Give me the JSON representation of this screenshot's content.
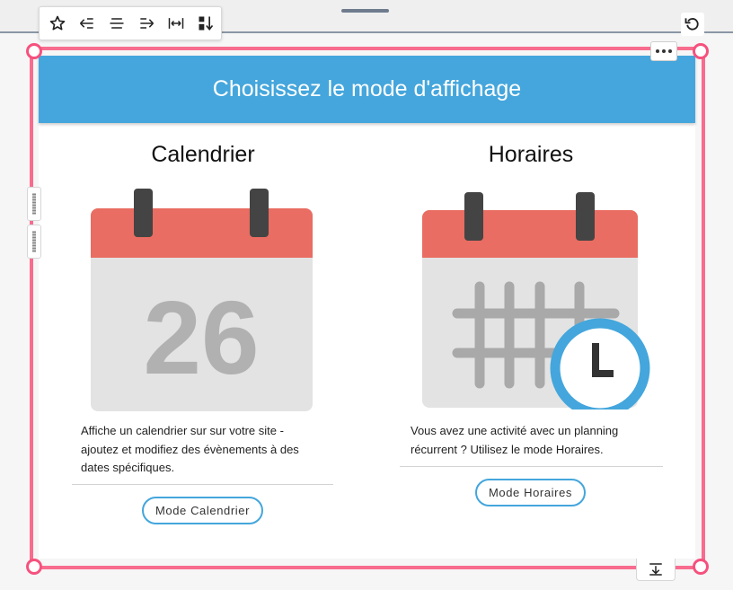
{
  "toolbar": {
    "icons": [
      "star-icon",
      "align-left-icon",
      "align-center-icon",
      "align-right-icon",
      "stretch-icon",
      "sort-icon"
    ]
  },
  "header": {
    "title": "Choisissez le mode d'affichage"
  },
  "calendar": {
    "title": "Calendrier",
    "day_number": "26",
    "description_lines": [
      "Affiche un calendrier sur sur votre site -",
      "ajoutez et modifiez des évènements à des",
      "dates spécifiques."
    ],
    "button_label": "Mode Calendrier"
  },
  "schedule": {
    "title": "Horaires",
    "description_lines": [
      "Vous avez une activité avec un planning",
      "récurrent ? Utilisez le mode Horaires."
    ],
    "button_label": "Mode Horaires"
  },
  "colors": {
    "accent_blue": "#44a6dc",
    "selection_pink": "#f86c8e",
    "calendar_red": "#e96d62",
    "calendar_gray": "#e3e3e3",
    "ring_dark": "#444444"
  }
}
